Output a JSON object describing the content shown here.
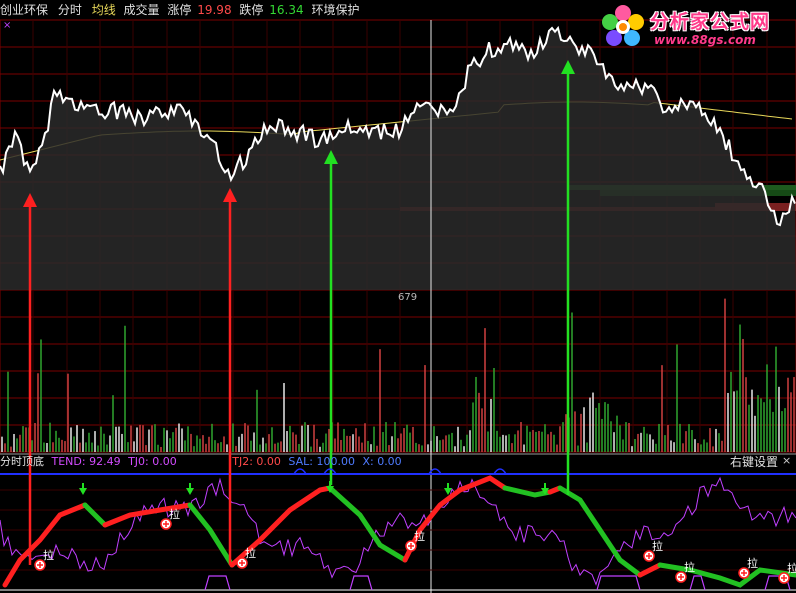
{
  "title_bar": {
    "indicator_name": "创业环保",
    "mode": "分时",
    "avg_line_label": "均线",
    "volume_label": "成交量",
    "limit_up_label": "涨停",
    "limit_up_value": "19.98",
    "limit_down_label": "跌停",
    "limit_down_value": "16.34",
    "stock_name": "环境保护"
  },
  "price_panel": {
    "center_value": "679",
    "close_mark": "×"
  },
  "indicator_bar": {
    "name": "分时顶底",
    "tend": "TEND: 92.49",
    "tj0": "TJ0: 0.00",
    "tj2": "TJ2: 0.00",
    "sal": "SAL: 100.00",
    "x": "X: 0.00",
    "right_click_settings": "右键设置",
    "close": "×"
  },
  "signal_label": "拉",
  "logo": {
    "title": "分析家公式网",
    "url": "www.88gs.com"
  },
  "colors": {
    "price_line": "#ffffff",
    "avg_line": "#e8d85a",
    "grid": "#7a0000",
    "vol_up": "#d04040",
    "vol_down": "#2fa52f",
    "arrow_buy": "#ff2020",
    "arrow_sell": "#22e022",
    "indicator_line": "#c040ff",
    "blue_line": "#2030ff"
  }
}
